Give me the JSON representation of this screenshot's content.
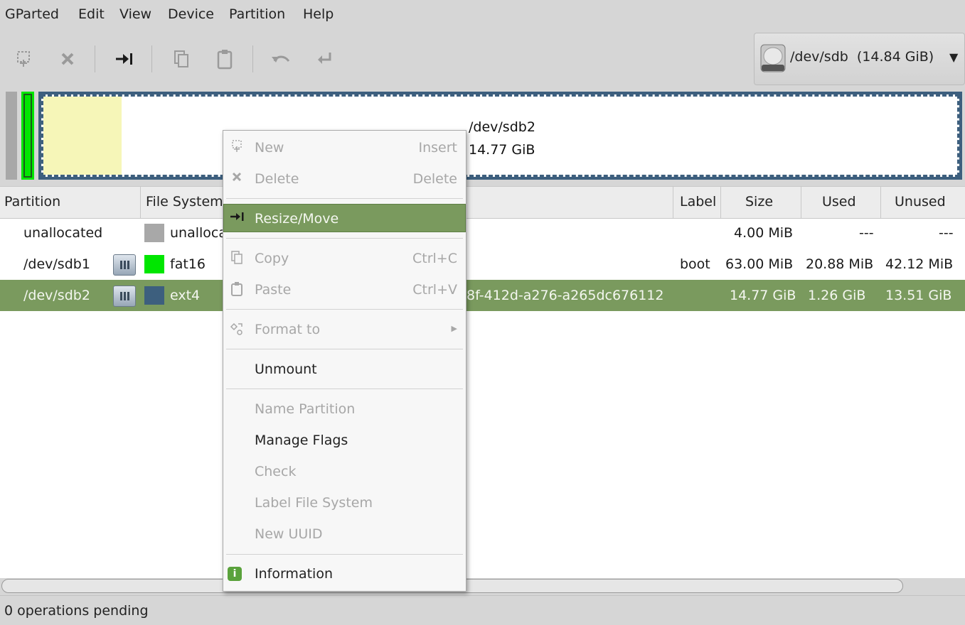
{
  "menubar": {
    "items": [
      "GParted",
      "Edit",
      "View",
      "Device",
      "Partition",
      "Help"
    ]
  },
  "toolbar": {
    "icons": [
      "new-partition-icon",
      "delete-icon",
      "resize-move-icon",
      "copy-icon",
      "paste-icon",
      "undo-icon",
      "apply-icon"
    ]
  },
  "device": {
    "label": "/dev/sdb  (14.84 GiB)"
  },
  "diskmap": {
    "partition_name": "/dev/sdb2",
    "partition_size": "14.77 GiB"
  },
  "table": {
    "columns": [
      "Partition",
      "File System",
      "Label",
      "Size",
      "Used",
      "Unused"
    ],
    "rows": [
      {
        "partition": "unallocated",
        "fs": "unallocated",
        "fs_color": "#a8a8a8",
        "label": "",
        "size": "4.00 MiB",
        "used": "---",
        "unused": "---",
        "tail": ""
      },
      {
        "partition": "/dev/sdb1",
        "fs": "fat16",
        "fs_color": "#00e600",
        "label": "boot",
        "size": "63.00 MiB",
        "used": "20.88 MiB",
        "unused": "42.12 MiB",
        "tail": ""
      },
      {
        "partition": "/dev/sdb2",
        "fs": "ext4",
        "fs_color": "#3d5f7e",
        "label": "",
        "size": "14.77 GiB",
        "used": "1.26 GiB",
        "unused": "13.51 GiB",
        "tail": "8f-412d-a276-a265dc676112"
      }
    ]
  },
  "status": {
    "text": "0 operations pending"
  },
  "context_menu": {
    "new": {
      "label": "New",
      "accel": "Insert"
    },
    "delete": {
      "label": "Delete",
      "accel": "Delete"
    },
    "resize": {
      "label": "Resize/Move"
    },
    "copy": {
      "label": "Copy",
      "accel": "Ctrl+C"
    },
    "paste": {
      "label": "Paste",
      "accel": "Ctrl+V"
    },
    "format": {
      "label": "Format to"
    },
    "unmount": {
      "label": "Unmount"
    },
    "name_partition": {
      "label": "Name Partition"
    },
    "manage_flags": {
      "label": "Manage Flags"
    },
    "check": {
      "label": "Check"
    },
    "label_fs": {
      "label": "Label File System"
    },
    "new_uuid": {
      "label": "New UUID"
    },
    "information": {
      "label": "Information"
    }
  },
  "colors": {
    "selection": "#7a9a5e",
    "ext4": "#3d5f7e",
    "fat16": "#00e600",
    "unallocated": "#a8a8a8"
  }
}
